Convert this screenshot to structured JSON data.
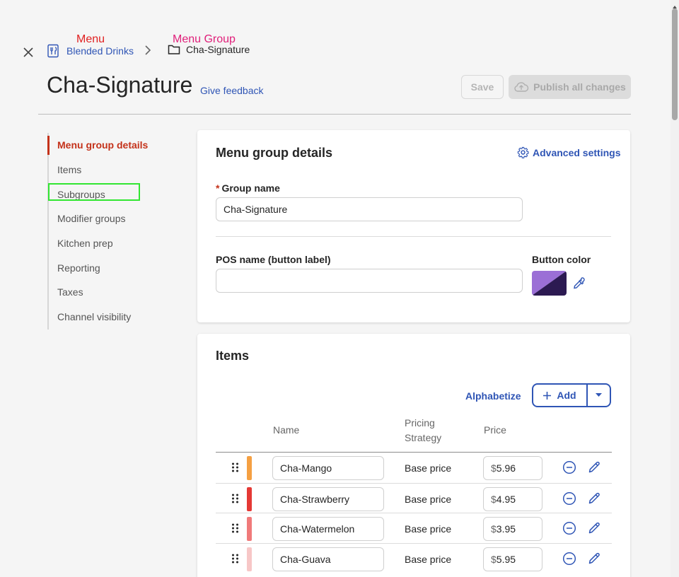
{
  "annotations": {
    "menu_tag": "Menu",
    "menu_group_tag": "Menu Group"
  },
  "breadcrumb": {
    "menu_label": "Blended Drinks",
    "group_label": "Cha-Signature"
  },
  "header": {
    "title": "Cha-Signature",
    "feedback_link": "Give feedback",
    "save_label": "Save",
    "publish_label": "Publish all changes"
  },
  "sidebar": {
    "items": [
      {
        "label": "Menu group details",
        "active": true
      },
      {
        "label": "Items"
      },
      {
        "label": "Subgroups"
      },
      {
        "label": "Modifier groups"
      },
      {
        "label": "Kitchen prep"
      },
      {
        "label": "Reporting"
      },
      {
        "label": "Taxes"
      },
      {
        "label": "Channel visibility"
      }
    ]
  },
  "details": {
    "title": "Menu group details",
    "advanced_label": "Advanced settings",
    "group_name_label": "Group name",
    "group_name_required_mark": "*",
    "group_name_value": "Cha-Signature",
    "pos_name_label": "POS name (button label)",
    "pos_name_value": "",
    "button_color_label": "Button color",
    "button_color_light": "#9b6fd6",
    "button_color_dark": "#2c1a52"
  },
  "items_section": {
    "title": "Items",
    "alphabetize_label": "Alphabetize",
    "add_label": "Add",
    "columns": {
      "name": "Name",
      "pricing_strategy": "Pricing\nStrategy",
      "price": "Price"
    },
    "currency_symbol": "$",
    "rows": [
      {
        "name": "Cha-Mango",
        "strategy": "Base price",
        "price": "5.96",
        "color": "#f5a042"
      },
      {
        "name": "Cha-Strawberry",
        "strategy": "Base price",
        "price": "4.95",
        "color": "#e53935"
      },
      {
        "name": "Cha-Watermelon",
        "strategy": "Base price",
        "price": "3.95",
        "color": "#f07a7a"
      },
      {
        "name": "Cha-Guava",
        "strategy": "Base price",
        "price": "5.95",
        "color": "#f7c7c7"
      }
    ]
  },
  "colors": {
    "accent": "#2f55b5",
    "active": "#c4321a",
    "highlight": "#32e632"
  }
}
